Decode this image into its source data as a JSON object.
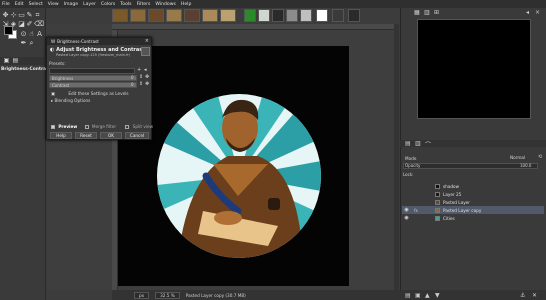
{
  "menu": [
    "File",
    "Edit",
    "Select",
    "View",
    "Image",
    "Layer",
    "Colors",
    "Tools",
    "Filters",
    "Windows",
    "Help"
  ],
  "tool_options": {
    "title": "Brightness-Contrast"
  },
  "dialog": {
    "window_title": "Brightness-Contrast",
    "heading": "Adjust Brightness and Contrast",
    "subtitle": "Pasted Layer copy-125 (fresbom_main.fr)",
    "presets_label": "Presets:",
    "brightness_label": "Brightness",
    "brightness_value": "0",
    "contrast_label": "Contrast",
    "contrast_value": "0",
    "levels_label": "Edit these Settings as Levels",
    "blending_label": "Blending Options",
    "preview_label": "Preview",
    "merge_label": "Merge filter",
    "split_label": "Split view",
    "buttons": {
      "help": "Help",
      "reset": "Reset",
      "ok": "OK",
      "cancel": "Cancel"
    }
  },
  "status": {
    "unit": "px",
    "zoom": "32.5 %",
    "info": "Pasted Layer copy (30.7 MB)"
  },
  "layers_panel": {
    "mode_label": "Mode",
    "mode_value": "Normal",
    "opacity_label": "Opacity",
    "opacity_value": "100.0",
    "lock_label": "Lock:",
    "layers": [
      {
        "name": "shadow",
        "visible": false,
        "selected": false,
        "thumb": "#111111"
      },
      {
        "name": "Layer 25",
        "visible": false,
        "selected": false,
        "thumb": "#1a1a1a"
      },
      {
        "name": "Pasted Layer",
        "visible": false,
        "selected": false,
        "thumb": "#6b4a2a"
      },
      {
        "name": "Pasted Layer copy",
        "visible": true,
        "selected": true,
        "thumb": "#8a6a3a"
      },
      {
        "name": "Cities",
        "visible": true,
        "selected": false,
        "thumb": "#3aa6a6"
      }
    ]
  },
  "colors": {
    "fg": "#000000",
    "bg": "#ffffff",
    "accent": "#505a6a",
    "teal": "#2c9fa6"
  }
}
